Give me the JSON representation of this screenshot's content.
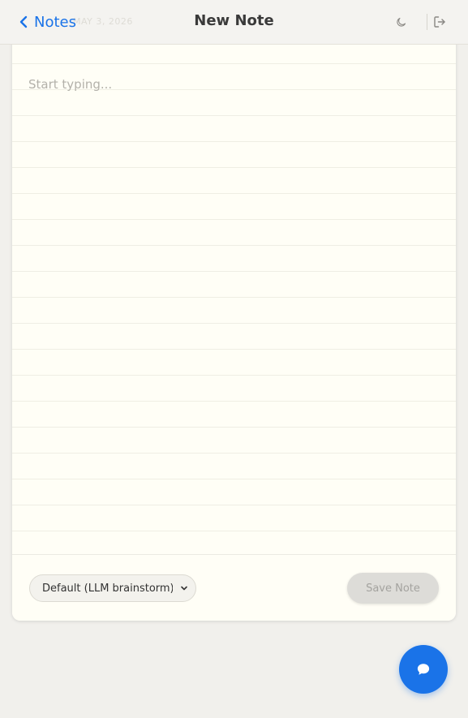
{
  "header": {
    "back_label": "Notes",
    "date": "MAY 3, 2026",
    "title": "New Note"
  },
  "icons": {
    "back": "chevron-left-icon",
    "theme": "moon-icon",
    "logout": "logout-icon",
    "chat": "chat-bubble-icon",
    "select": "chevron-down-icon"
  },
  "editor": {
    "placeholder": "Start typing...",
    "value": ""
  },
  "footer": {
    "mode_selected": "Default (LLM brainstorm)",
    "save_label": "Save Note",
    "save_disabled": true
  },
  "colors": {
    "accent": "#1a73e8",
    "background": "#f1f0ec",
    "paper": "#fffef6",
    "disabled_button": "#dddcd8"
  }
}
